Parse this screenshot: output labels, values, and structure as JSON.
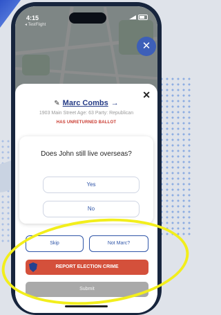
{
  "status": {
    "time": "4:15",
    "back_label": "◂ TestFlight"
  },
  "voter": {
    "name": "Marc Combs",
    "info": "1903 Main Street  Age: 63  Party: Republican",
    "warning": "HAS UNRETURNED BALLOT"
  },
  "question": {
    "text": "Does John still live overseas?",
    "options": [
      "Yes",
      "No"
    ]
  },
  "actions": {
    "skip": "Skip",
    "not_marc": "Not Marc?",
    "report": "REPORT ELECTION CRIME",
    "submit": "Submit"
  },
  "icons": {
    "close": "close-icon",
    "edit": "edit-icon",
    "arrow": "arrow-right-icon",
    "shield": "shield-icon"
  },
  "colors": {
    "accent": "#2f55a8",
    "report": "#d4503b",
    "submit": "#a9a9a9",
    "highlight": "#f2ee1c"
  }
}
